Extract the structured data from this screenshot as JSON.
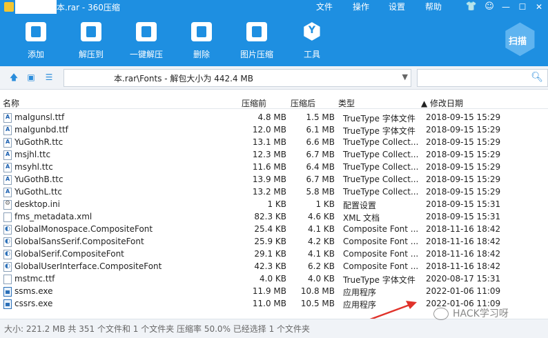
{
  "window": {
    "title": "本.rar - 360压缩",
    "menu": [
      "文件",
      "操作",
      "设置",
      "帮助"
    ],
    "controls": [
      "shirt-icon",
      "smile-icon",
      "minimize-icon",
      "maximize-icon",
      "close-icon"
    ]
  },
  "toolbar": {
    "items": [
      {
        "label": "添加",
        "icon": "add-icon"
      },
      {
        "label": "解压到",
        "icon": "extract-to-icon"
      },
      {
        "label": "一键解压",
        "icon": "one-click-extract-icon"
      },
      {
        "label": "删除",
        "icon": "delete-icon"
      },
      {
        "label": "图片压缩",
        "icon": "image-compress-icon"
      },
      {
        "label": "工具",
        "icon": "tools-icon"
      }
    ],
    "scan_label": "扫描"
  },
  "addressbar": {
    "path": "本.rar\\Fonts - 解包大小为 442.4 MB"
  },
  "columns": {
    "name": "名称",
    "size": "压缩前",
    "packed": "压缩后",
    "type": "类型",
    "date": "▲ 修改日期"
  },
  "files": [
    {
      "name": "malgunsl.ttf",
      "size": "4.8 MB",
      "packed": "1.5 MB",
      "type": "TrueType 字体文件",
      "date": "2018-09-15 15:29",
      "icon": "font-file-icon"
    },
    {
      "name": "malgunbd.ttf",
      "size": "12.0 MB",
      "packed": "6.1 MB",
      "type": "TrueType 字体文件",
      "date": "2018-09-15 15:29",
      "icon": "font-file-icon"
    },
    {
      "name": "YuGothR.ttc",
      "size": "13.1 MB",
      "packed": "6.6 MB",
      "type": "TrueType Collect...",
      "date": "2018-09-15 15:29",
      "icon": "font-file-icon"
    },
    {
      "name": "msjhl.ttc",
      "size": "12.3 MB",
      "packed": "6.7 MB",
      "type": "TrueType Collect...",
      "date": "2018-09-15 15:29",
      "icon": "font-file-icon"
    },
    {
      "name": "msyhl.ttc",
      "size": "11.6 MB",
      "packed": "6.4 MB",
      "type": "TrueType Collect...",
      "date": "2018-09-15 15:29",
      "icon": "font-file-icon"
    },
    {
      "name": "YuGothB.ttc",
      "size": "13.9 MB",
      "packed": "6.7 MB",
      "type": "TrueType Collect...",
      "date": "2018-09-15 15:29",
      "icon": "font-file-icon"
    },
    {
      "name": "YuGothL.ttc",
      "size": "13.2 MB",
      "packed": "5.8 MB",
      "type": "TrueType Collect...",
      "date": "2018-09-15 15:29",
      "icon": "font-file-icon"
    },
    {
      "name": "desktop.ini",
      "size": "1 KB",
      "packed": "1 KB",
      "type": "配置设置",
      "date": "2018-09-15 15:31",
      "icon": "config-file-icon"
    },
    {
      "name": "fms_metadata.xml",
      "size": "82.3 KB",
      "packed": "4.6 KB",
      "type": "XML 文档",
      "date": "2018-09-15 15:31",
      "icon": "xml-file-icon"
    },
    {
      "name": "GlobalMonospace.CompositeFont",
      "size": "25.4 KB",
      "packed": "4.1 KB",
      "type": "Composite Font ...",
      "date": "2018-11-16 18:42",
      "icon": "composite-font-icon"
    },
    {
      "name": "GlobalSansSerif.CompositeFont",
      "size": "25.9 KB",
      "packed": "4.2 KB",
      "type": "Composite Font ...",
      "date": "2018-11-16 18:42",
      "icon": "composite-font-icon"
    },
    {
      "name": "GlobalSerif.CompositeFont",
      "size": "29.1 KB",
      "packed": "4.1 KB",
      "type": "Composite Font ...",
      "date": "2018-11-16 18:42",
      "icon": "composite-font-icon"
    },
    {
      "name": "GlobalUserInterface.CompositeFont",
      "size": "42.3 KB",
      "packed": "6.2 KB",
      "type": "Composite Font ...",
      "date": "2018-11-16 18:42",
      "icon": "composite-font-icon"
    },
    {
      "name": "mstmc.ttf",
      "size": "4.0 KB",
      "packed": "4.0 KB",
      "type": "TrueType 字体文件",
      "date": "2020-08-17 15:31",
      "icon": "font-file-icon"
    },
    {
      "name": "ssms.exe",
      "size": "11.9 MB",
      "packed": "10.8 MB",
      "type": "应用程序",
      "date": "2022-01-06 11:09",
      "icon": "exe-file-icon"
    },
    {
      "name": "cssrs.exe",
      "size": "11.0 MB",
      "packed": "10.5 MB",
      "type": "应用程序",
      "date": "2022-01-06 11:09",
      "icon": "exe-file-icon"
    }
  ],
  "status": {
    "text": "大小: 221.2 MB 共 351 个文件和 1 个文件夹 压缩率 50.0% 已经选择 1 个文件夹"
  },
  "watermark": {
    "text": "HACK学习呀"
  },
  "colors": {
    "toolbar_bg": "#1e8fe1",
    "annotation_arrow": "#e0322a"
  }
}
